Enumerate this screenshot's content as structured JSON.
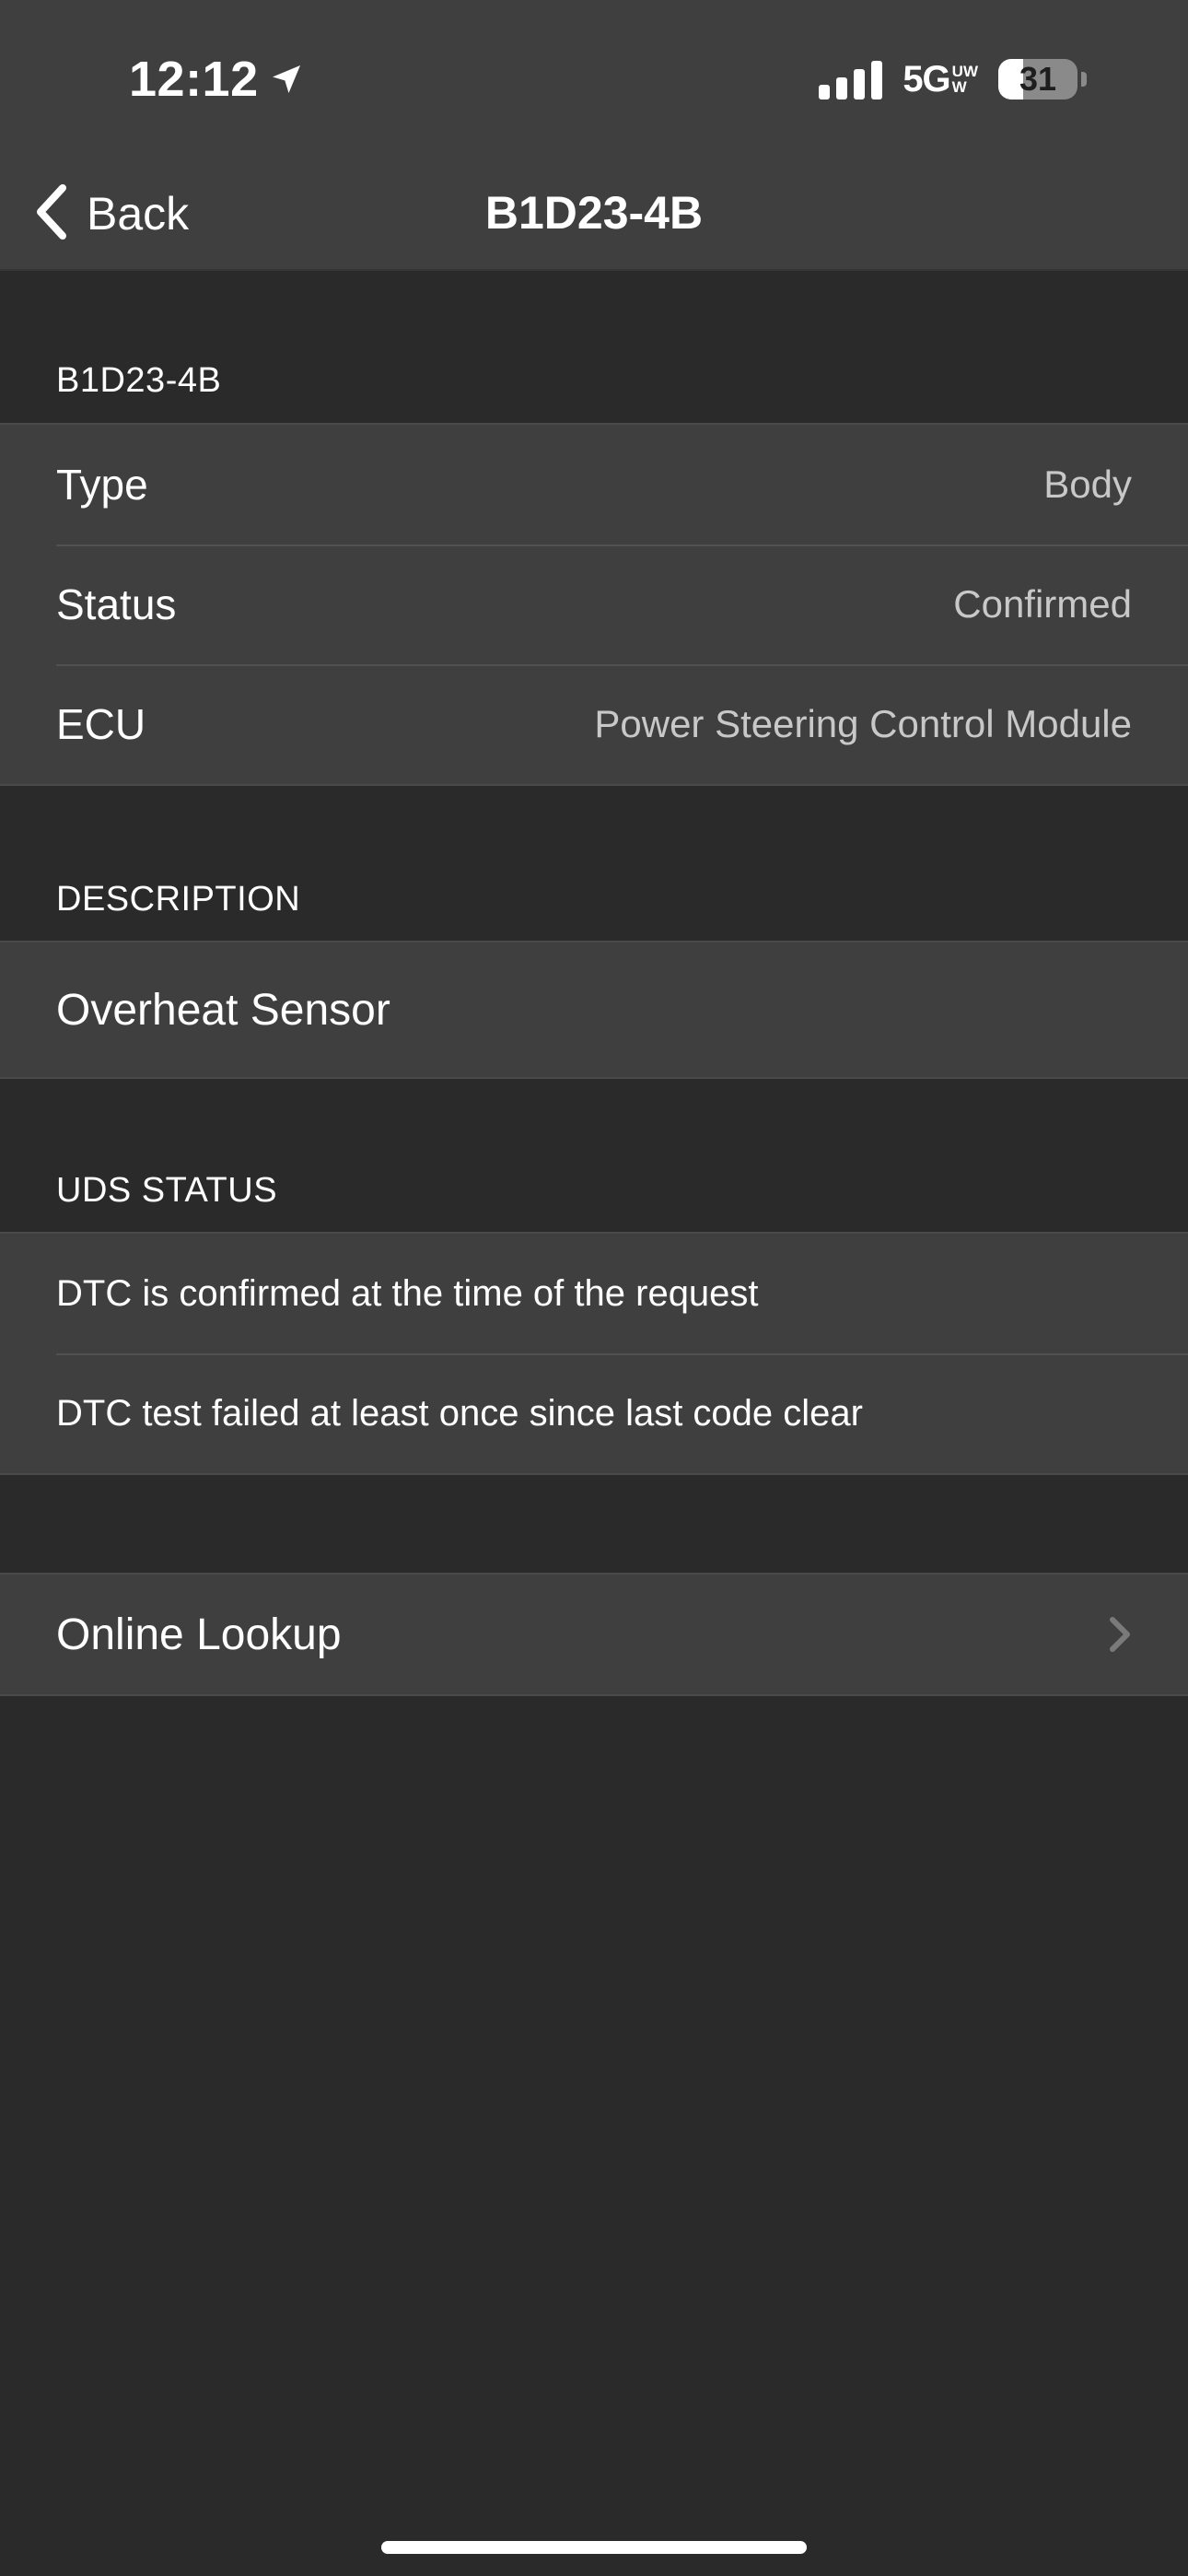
{
  "status_bar": {
    "time": "12:12",
    "network": "5G",
    "network_badge_top": "UW",
    "network_badge_bottom": "W",
    "battery": "31",
    "battery_level_percent": 31,
    "icons": [
      "location-arrow-icon",
      "signal-icon",
      "battery-icon"
    ]
  },
  "nav": {
    "back_label": "Back",
    "title": "B1D23-4B"
  },
  "code_section": {
    "header": "B1D23-4B",
    "rows": [
      {
        "label": "Type",
        "value": "Body"
      },
      {
        "label": "Status",
        "value": "Confirmed"
      },
      {
        "label": "ECU",
        "value": "Power Steering Control Module"
      }
    ]
  },
  "description_section": {
    "header": "DESCRIPTION",
    "text": "Overheat Sensor"
  },
  "uds_section": {
    "header": "UDS STATUS",
    "items": [
      "DTC is confirmed at the time of the request",
      "DTC test failed at least once since last code clear"
    ]
  },
  "lookup": {
    "label": "Online Lookup",
    "icon": "chevron-right-icon"
  },
  "colors": {
    "background": "#2a2a2a",
    "cell": "#3f3f3f",
    "value_text": "#c8c8c8",
    "chevron": "#7a7a7a"
  }
}
